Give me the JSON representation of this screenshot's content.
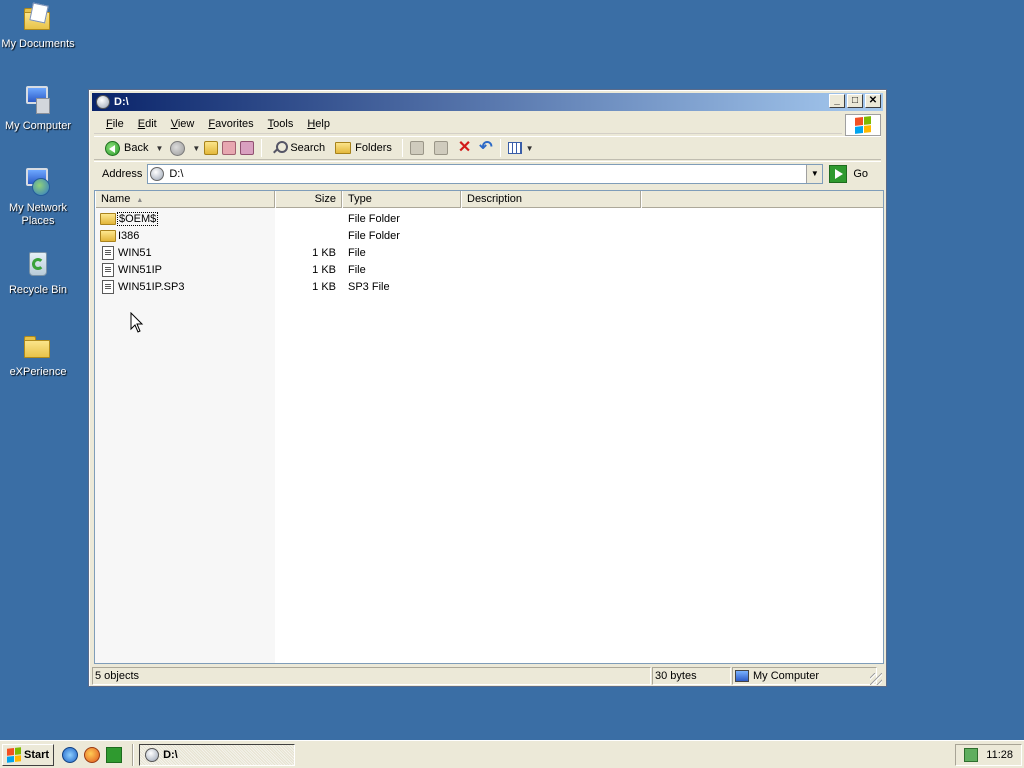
{
  "desktop": {
    "icons": [
      {
        "label": "My Documents",
        "icon": "my-documents-icon"
      },
      {
        "label": "My Computer",
        "icon": "my-computer-icon"
      },
      {
        "label": "My Network Places",
        "icon": "network-places-icon"
      },
      {
        "label": "Recycle Bin",
        "icon": "recycle-bin-icon"
      },
      {
        "label": "eXPerience",
        "icon": "folder-icon"
      }
    ]
  },
  "window": {
    "title": "D:\\",
    "menu": [
      "File",
      "Edit",
      "View",
      "Favorites",
      "Tools",
      "Help"
    ],
    "toolbar": {
      "back": "Back",
      "search": "Search",
      "folders": "Folders"
    },
    "address": {
      "label": "Address",
      "value": "D:\\",
      "go": "Go"
    },
    "columns": {
      "name": "Name",
      "size": "Size",
      "type": "Type",
      "description": "Description"
    },
    "files": [
      {
        "name": "$OEM$",
        "size": "",
        "type": "File Folder",
        "kind": "folder"
      },
      {
        "name": "I386",
        "size": "",
        "type": "File Folder",
        "kind": "folder"
      },
      {
        "name": "WIN51",
        "size": "1 KB",
        "type": "File",
        "kind": "file"
      },
      {
        "name": "WIN51IP",
        "size": "1 KB",
        "type": "File",
        "kind": "file"
      },
      {
        "name": "WIN51IP.SP3",
        "size": "1 KB",
        "type": "SP3 File",
        "kind": "file"
      }
    ],
    "status": {
      "objects": "5 objects",
      "bytes": "30 bytes",
      "zone": "My Computer"
    }
  },
  "taskbar": {
    "start": "Start",
    "task": "D:\\",
    "clock": "11:28"
  },
  "colors": {
    "desktop": "#3a6ea5",
    "titlebar_start": "#0a246a",
    "titlebar_end": "#a6caf0",
    "chrome": "#ece9d8"
  }
}
